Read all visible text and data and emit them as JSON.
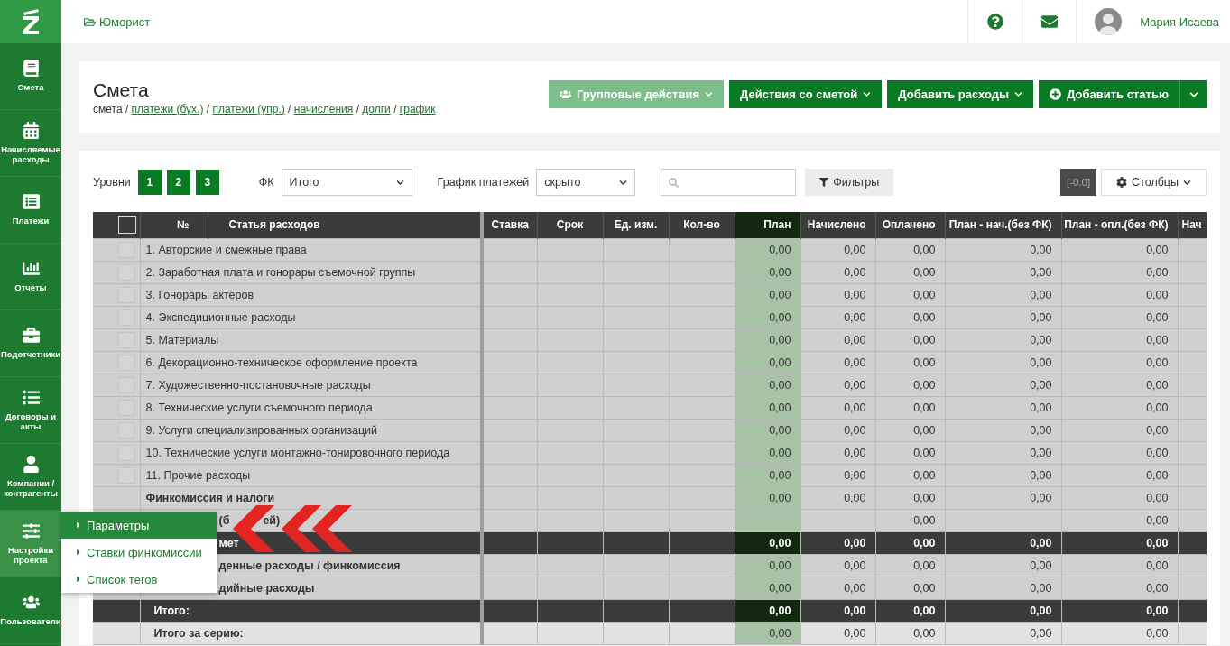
{
  "sidebar": {
    "items": [
      {
        "label": "Смета",
        "selected": false
      },
      {
        "label": "Начисляемые расходы",
        "selected": false
      },
      {
        "label": "Платежи",
        "selected": false
      },
      {
        "label": "Отчеты",
        "selected": false
      },
      {
        "label": "Подотчетники",
        "selected": false
      },
      {
        "label": "Договоры и акты",
        "selected": false
      },
      {
        "label": "Компании / контрагенты",
        "selected": false
      },
      {
        "label": "Настройки проекта",
        "selected": true
      },
      {
        "label": "Пользователи",
        "selected": false
      }
    ]
  },
  "topbar": {
    "project": "Юморист",
    "user": "Мария Исаева"
  },
  "header": {
    "title": "Смета",
    "breadcrumb_separator": "/",
    "breadcrumbs": [
      {
        "label": "смета",
        "link": false
      },
      {
        "label": "платежи (бух.)",
        "link": true
      },
      {
        "label": "платежи (упр.)",
        "link": true
      },
      {
        "label": "начисления",
        "link": true
      },
      {
        "label": "долги",
        "link": true
      },
      {
        "label": "график",
        "link": true
      }
    ],
    "buttons": [
      {
        "kind": "dropdown",
        "label": "Групповые действия",
        "disabled": true
      },
      {
        "kind": "dropdown",
        "label": "Действия со сметой",
        "disabled": false
      },
      {
        "kind": "dropdown",
        "label": "Добавить расходы",
        "disabled": false
      },
      {
        "kind": "split",
        "label": "Добавить статью",
        "disabled": false
      }
    ]
  },
  "filters": {
    "levels_label": "Уровни",
    "levels": [
      "1",
      "2",
      "3"
    ],
    "fk_label": "ФК",
    "fk_value": "Итого",
    "schedule_label": "График платежей",
    "schedule_value": "скрыто",
    "filters_button": "Фильтры",
    "badge": "[-0.0]",
    "columns_button": "Столбцы"
  },
  "table": {
    "select_all": {
      "checked": false
    },
    "number_header": "№",
    "label_header": "Статья расходов",
    "columns": [
      "Ставка",
      "Срок",
      "Ед. изм.",
      "Кол-во",
      "План",
      "Начислено",
      "Оплачено",
      "План - нач.(без ФК)",
      "План - опл.(без ФК)",
      "Нач"
    ],
    "rows": [
      {
        "kind": "item",
        "checked": false,
        "covered": false,
        "label_parts": [
          "1. Авторские и смежные права"
        ],
        "cells": [
          null,
          null,
          null,
          null,
          "0,00",
          "0,00",
          "0,00",
          "0,00",
          "0,00",
          null
        ]
      },
      {
        "kind": "item",
        "checked": false,
        "covered": false,
        "label_parts": [
          "2. Заработная плата и гонорары съемочной группы"
        ],
        "cells": [
          null,
          null,
          null,
          null,
          "0,00",
          "0,00",
          "0,00",
          "0,00",
          "0,00",
          null
        ]
      },
      {
        "kind": "item",
        "checked": false,
        "covered": false,
        "label_parts": [
          "3. Гонорары актеров"
        ],
        "cells": [
          null,
          null,
          null,
          null,
          "0,00",
          "0,00",
          "0,00",
          "0,00",
          "0,00",
          null
        ]
      },
      {
        "kind": "item",
        "checked": false,
        "covered": false,
        "label_parts": [
          "4. Экспедиционные расходы"
        ],
        "cells": [
          null,
          null,
          null,
          null,
          "0,00",
          "0,00",
          "0,00",
          "0,00",
          "0,00",
          null
        ]
      },
      {
        "kind": "item",
        "checked": false,
        "covered": false,
        "label_parts": [
          "5. Материалы"
        ],
        "cells": [
          null,
          null,
          null,
          null,
          "0,00",
          "0,00",
          "0,00",
          "0,00",
          "0,00",
          null
        ]
      },
      {
        "kind": "item",
        "checked": false,
        "covered": false,
        "label_parts": [
          "6. Декорационно-техническое оформление проекта"
        ],
        "cells": [
          null,
          null,
          null,
          null,
          "0,00",
          "0,00",
          "0,00",
          "0,00",
          "0,00",
          null
        ]
      },
      {
        "kind": "item",
        "checked": false,
        "covered": false,
        "label_parts": [
          "7. Художественно-постановочные расходы"
        ],
        "cells": [
          null,
          null,
          null,
          null,
          "0,00",
          "0,00",
          "0,00",
          "0,00",
          "0,00",
          null
        ]
      },
      {
        "kind": "item",
        "checked": false,
        "covered": false,
        "label_parts": [
          "8. Технические услуги съемочного периода"
        ],
        "cells": [
          null,
          null,
          null,
          null,
          "0,00",
          "0,00",
          "0,00",
          "0,00",
          "0,00",
          null
        ]
      },
      {
        "kind": "item",
        "checked": false,
        "covered": false,
        "label_parts": [
          "9. Услуги специализированных организаций"
        ],
        "cells": [
          null,
          null,
          null,
          null,
          "0,00",
          "0,00",
          "0,00",
          "0,00",
          "0,00",
          null
        ]
      },
      {
        "kind": "item",
        "checked": false,
        "covered": false,
        "label_parts": [
          "10. Технические услуги монтажно-тонировочного периода"
        ],
        "cells": [
          null,
          null,
          null,
          null,
          "0,00",
          "0,00",
          "0,00",
          "0,00",
          "0,00",
          null
        ]
      },
      {
        "kind": "item",
        "checked": false,
        "covered": false,
        "label_parts": [
          "11. Прочие расходы"
        ],
        "cells": [
          null,
          null,
          null,
          null,
          "0,00",
          "0,00",
          "0,00",
          "0,00",
          "0,00",
          null
        ]
      },
      {
        "kind": "group",
        "covered": false,
        "label_parts": [
          "Финкомиссия и налоги"
        ],
        "cells": [
          null,
          null,
          null,
          null,
          "0,00",
          "0,00",
          "0,00",
          "0,00",
          "0,00",
          null
        ]
      },
      {
        "kind": "group",
        "covered": true,
        "label_parts": [
          "(б",
          "ей)"
        ],
        "cells": [
          null,
          null,
          null,
          null,
          null,
          null,
          "0,00",
          null,
          "0,00",
          null
        ]
      },
      {
        "kind": "total",
        "covered": true,
        "label_parts": [
          "мет"
        ],
        "cells": [
          null,
          null,
          null,
          null,
          "0,00",
          "0,00",
          "0,00",
          "0,00",
          "0,00",
          null
        ]
      },
      {
        "kind": "group",
        "covered": true,
        "label_parts": [
          "денные расходы / финкомиссия"
        ],
        "cells": [
          null,
          null,
          null,
          null,
          "0,00",
          "0,00",
          "0,00",
          "0,00",
          "0,00",
          null
        ]
      },
      {
        "kind": "group",
        "covered": true,
        "label_parts": [
          "дийные расходы"
        ],
        "cells": [
          null,
          null,
          null,
          null,
          "0,00",
          "0,00",
          "0,00",
          "0,00",
          "0,00",
          null
        ]
      },
      {
        "kind": "total",
        "label_parts": [
          "Итого:"
        ],
        "cells": [
          null,
          null,
          null,
          null,
          "0,00",
          "0,00",
          "0,00",
          "0,00",
          "0,00",
          null
        ]
      },
      {
        "kind": "series",
        "label_parts": [
          "Итого за серию:"
        ],
        "cells": [
          null,
          null,
          null,
          null,
          "0,00",
          "0,00",
          "0,00",
          "0,00",
          "0,00",
          null
        ]
      }
    ]
  },
  "submenu": {
    "items": [
      {
        "label": "Параметры",
        "selected": true
      },
      {
        "label": "Ставки финкомиссии",
        "selected": false
      },
      {
        "label": "Список тегов",
        "selected": false
      }
    ]
  }
}
